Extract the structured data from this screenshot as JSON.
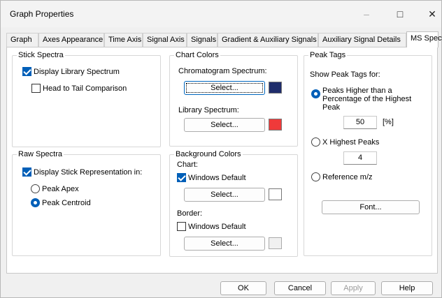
{
  "window": {
    "title": "Graph Properties"
  },
  "titlebar": {
    "min_icon": "–",
    "max_icon": "□",
    "close_icon": "✕"
  },
  "tabs": [
    {
      "label": "Graph"
    },
    {
      "label": "Axes Appearance"
    },
    {
      "label": "Time Axis"
    },
    {
      "label": "Signal Axis"
    },
    {
      "label": "Signals"
    },
    {
      "label": "Gradient & Auxiliary Signals"
    },
    {
      "label": "Auxiliary Signal Details"
    },
    {
      "label": "MS Spectra",
      "active": true
    }
  ],
  "stick_spectra": {
    "title": "Stick Spectra",
    "display_library": {
      "label": "Display Library Spectrum",
      "checked": true
    },
    "head_to_tail": {
      "label": "Head to Tail Comparison",
      "checked": false
    }
  },
  "raw_spectra": {
    "title": "Raw Spectra",
    "display_stick": {
      "label": "Display Stick Representation in:",
      "checked": true
    },
    "peak_apex": {
      "label": "Peak Apex",
      "selected": false
    },
    "peak_centroid": {
      "label": "Peak Centroid",
      "selected": true
    }
  },
  "chart_colors": {
    "title": "Chart Colors",
    "chromatogram_label": "Chromatogram Spectrum:",
    "chromatogram_select": "Select...",
    "chromatogram_color": "#1f2d6b",
    "library_label": "Library Spectrum:",
    "library_select": "Select...",
    "library_color": "#ef3a3a"
  },
  "background_colors": {
    "title": "Background Colors",
    "chart_label": "Chart:",
    "chart_windows_default": {
      "label": "Windows Default",
      "checked": true
    },
    "chart_select": "Select...",
    "chart_color": "#ffffff",
    "border_label": "Border:",
    "border_windows_default": {
      "label": "Windows Default",
      "checked": false
    },
    "border_select": "Select...",
    "border_color": "#f0f0f0"
  },
  "peak_tags": {
    "title": "Peak Tags",
    "show_label": "Show Peak Tags for:",
    "percentage_option": "Peaks Higher than a Percentage of the Highest Peak",
    "percentage_value": "50",
    "percentage_unit": "[%]",
    "x_highest_option": "X Highest Peaks",
    "x_highest_value": "4",
    "reference_option": "Reference m/z",
    "font_button": "Font..."
  },
  "footer": {
    "ok": "OK",
    "cancel": "Cancel",
    "apply": "Apply",
    "help": "Help"
  }
}
